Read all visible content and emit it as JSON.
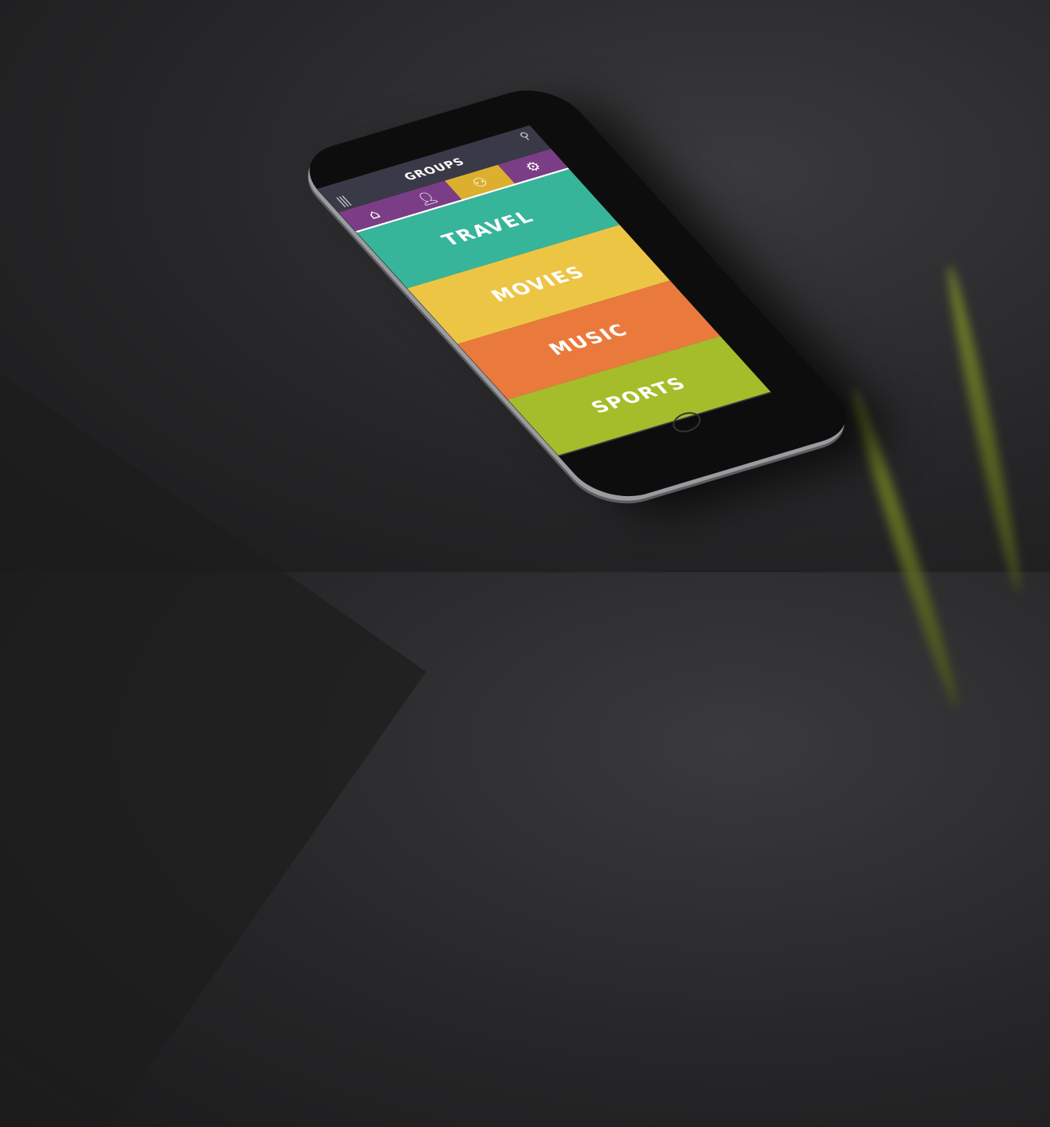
{
  "app": {
    "title": "GROUPS"
  },
  "icons": {
    "menu": "menu-icon",
    "search": "search-icon",
    "home": "home-icon",
    "user": "user-icon",
    "groups": "groups-icon",
    "settings": "gear-icon"
  },
  "tabs": [
    {
      "name": "home",
      "glyph": "⌂",
      "color": "#7b3e86"
    },
    {
      "name": "profile",
      "glyph": "👤︎",
      "color": "#7b3e86"
    },
    {
      "name": "groups",
      "glyph": "⚇",
      "color": "#dcb02e",
      "active": true
    },
    {
      "name": "settings",
      "glyph": "⚙",
      "color": "#7b3e86"
    }
  ],
  "categories": [
    {
      "label": "TRAVEL",
      "color": "#36b59a"
    },
    {
      "label": "MOVIES",
      "color": "#ecc545"
    },
    {
      "label": "MUSIC",
      "color": "#ea7a3c"
    },
    {
      "label": "SPORTS",
      "color": "#a5bd2a"
    }
  ]
}
